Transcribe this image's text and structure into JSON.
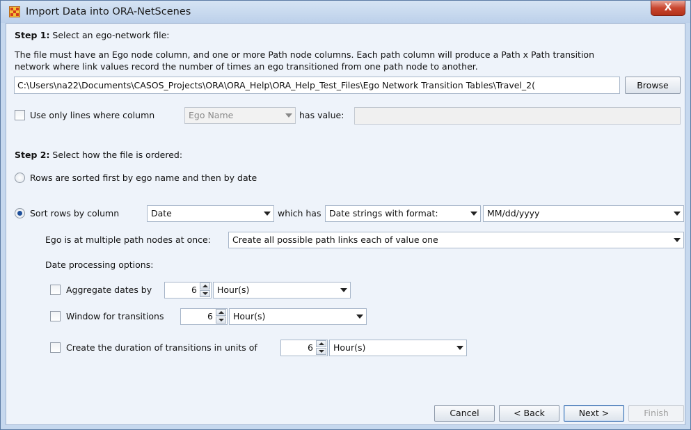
{
  "window": {
    "title": "Import Data into ORA-NetScenes",
    "close_label": "X"
  },
  "step1": {
    "heading": "Step 1:",
    "heading_rest": " Select an ego-network file:",
    "description_line1": "The file must have an Ego node column, and one or more Path node columns. Each path column will produce a Path x Path transition",
    "description_line2": "network where link values record the number of times an ego transitioned from one path node to another.",
    "file_path": "C:\\Users\\na22\\Documents\\CASOS_Projects\\ORA\\ORA_Help\\ORA_Help_Test_Files\\Ego Network Transition Tables\\Travel_2(",
    "browse_label": "Browse",
    "filter_checkbox_label": "Use only lines where column",
    "filter_column_value": "Ego Name",
    "filter_has_value_label": "has value:",
    "filter_value": ""
  },
  "step2": {
    "heading": "Step 2:",
    "heading_rest": " Select how the file is ordered:",
    "radio_sorted_label": "Rows are sorted first by ego name and then by date",
    "radio_sort_by_label": "Sort rows by column",
    "sort_column_value": "Date",
    "which_has_label": "which has",
    "which_has_value": "Date strings with format:",
    "date_format_value": "MM/dd/yyyy",
    "multiple_path_label": "Ego is at multiple path nodes at once:",
    "multiple_path_value": "Create all possible path links each of value one",
    "date_options_label": "Date processing options:",
    "aggregate_label": "Aggregate dates by",
    "aggregate_value": "6",
    "aggregate_unit": "Hour(s)",
    "window_label": "Window for transitions",
    "window_value": "6",
    "window_unit": "Hour(s)",
    "duration_label": "Create the duration of transitions in units of",
    "duration_value": "6",
    "duration_unit": "Hour(s)"
  },
  "footer": {
    "cancel_label": "Cancel",
    "back_label": "< Back",
    "next_label": "Next >",
    "finish_label": "Finish"
  },
  "colors": {
    "title_bar": "#c9dbef",
    "content_bg": "#eef3fa",
    "radio_dot": "#1e4f9a",
    "close_red": "#c9462f"
  }
}
